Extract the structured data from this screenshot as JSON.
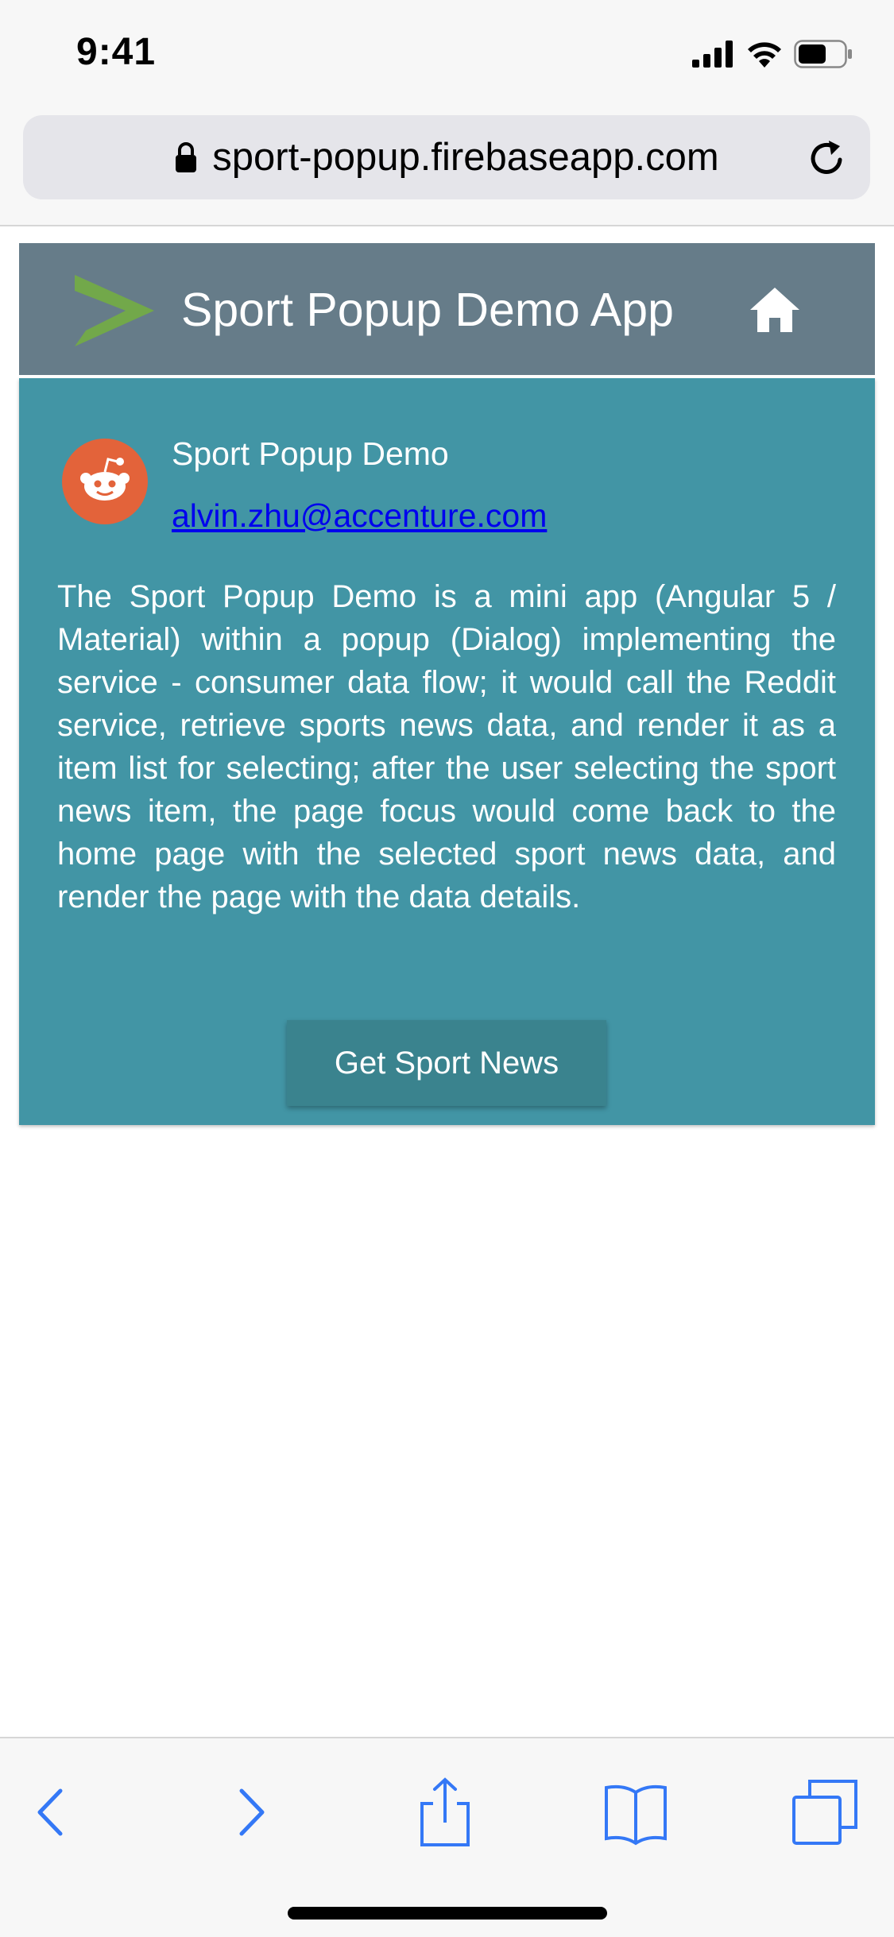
{
  "status_bar": {
    "time": "9:41"
  },
  "browser": {
    "url": "sport-popup.firebaseapp.com"
  },
  "app_header": {
    "title": "Sport Popup Demo App"
  },
  "card": {
    "title": "Sport Popup Demo",
    "email": "alvin.zhu@accenture.com",
    "description": "The Sport Popup Demo is a mini app (Angular 5 / Material) within a popup (Dialog) implementing the service - consumer data flow; it would call the Reddit service, retrieve sports news data, and render it as a item list for selecting; after the user selecting the sport news item, the page focus would come back to the home page with the selected sport news data, and render the page with the data details.",
    "button_label": "Get Sport News"
  },
  "colors": {
    "header_bg": "#667c89",
    "card_bg": "#4295a5",
    "button_bg": "#3a838e",
    "logo_green": "#72a84a",
    "avatar_orange": "#e3633a",
    "ios_blue": "#3478f6"
  },
  "icons": [
    "lock-icon",
    "reload-icon",
    "logo-chevron-icon",
    "home-icon",
    "reddit-avatar-icon",
    "back-icon",
    "forward-icon",
    "share-icon",
    "bookmarks-icon",
    "tabs-icon"
  ]
}
